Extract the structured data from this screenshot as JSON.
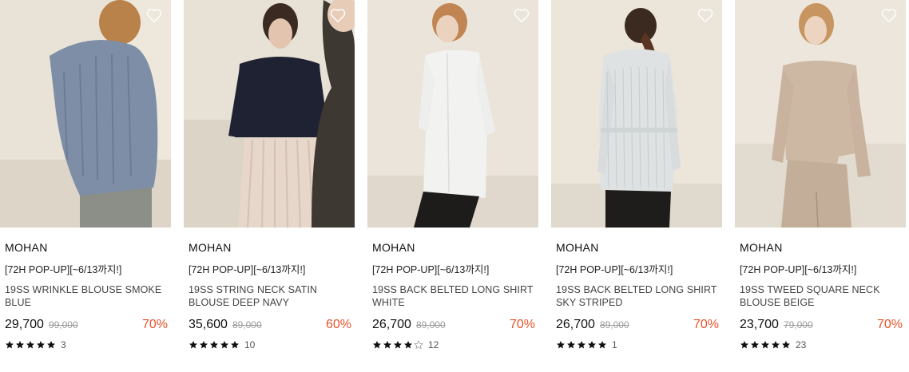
{
  "products": [
    {
      "brand": "MOHAN",
      "promo": "[72H POP-UP][~6/13까지!]",
      "name": "19SS WRINKLE BLOUSE SMOKE BLUE",
      "price": "29,700",
      "original_price": "99,000",
      "discount": "70%",
      "rating": 5,
      "review_count": "3",
      "garment_color": "#7d8ea6"
    },
    {
      "brand": "MOHAN",
      "promo": "[72H POP-UP][~6/13까지!]",
      "name": "19SS STRING NECK SATIN BLOUSE DEEP NAVY",
      "price": "35,600",
      "original_price": "89,000",
      "discount": "60%",
      "rating": 5,
      "review_count": "10",
      "garment_color": "#1f2233"
    },
    {
      "brand": "MOHAN",
      "promo": "[72H POP-UP][~6/13까지!]",
      "name": "19SS BACK BELTED LONG SHIRT WHITE",
      "price": "26,700",
      "original_price": "89,000",
      "discount": "70%",
      "rating": 4,
      "review_count": "12",
      "garment_color": "#f2f2f0"
    },
    {
      "brand": "MOHAN",
      "promo": "[72H POP-UP][~6/13까지!]",
      "name": "19SS BACK BELTED LONG SHIRT SKY STRIPED",
      "price": "26,700",
      "original_price": "89,000",
      "discount": "70%",
      "rating": 5,
      "review_count": "1",
      "garment_color": "#dfe2e2"
    },
    {
      "brand": "MOHAN",
      "promo": "[72H POP-UP][~6/13까지!]",
      "name": "19SS TWEED SQUARE NECK BLOUSE BEIGE",
      "price": "23,700",
      "original_price": "79,000",
      "discount": "70%",
      "rating": 5,
      "review_count": "23",
      "garment_color": "#cdb8a4"
    }
  ],
  "icons": {
    "wishlist": "heart-outline-icon",
    "star_filled": "star-filled-icon",
    "star_empty": "star-empty-icon"
  },
  "colors": {
    "discount": "#e8532b",
    "background": "#ffffff"
  }
}
